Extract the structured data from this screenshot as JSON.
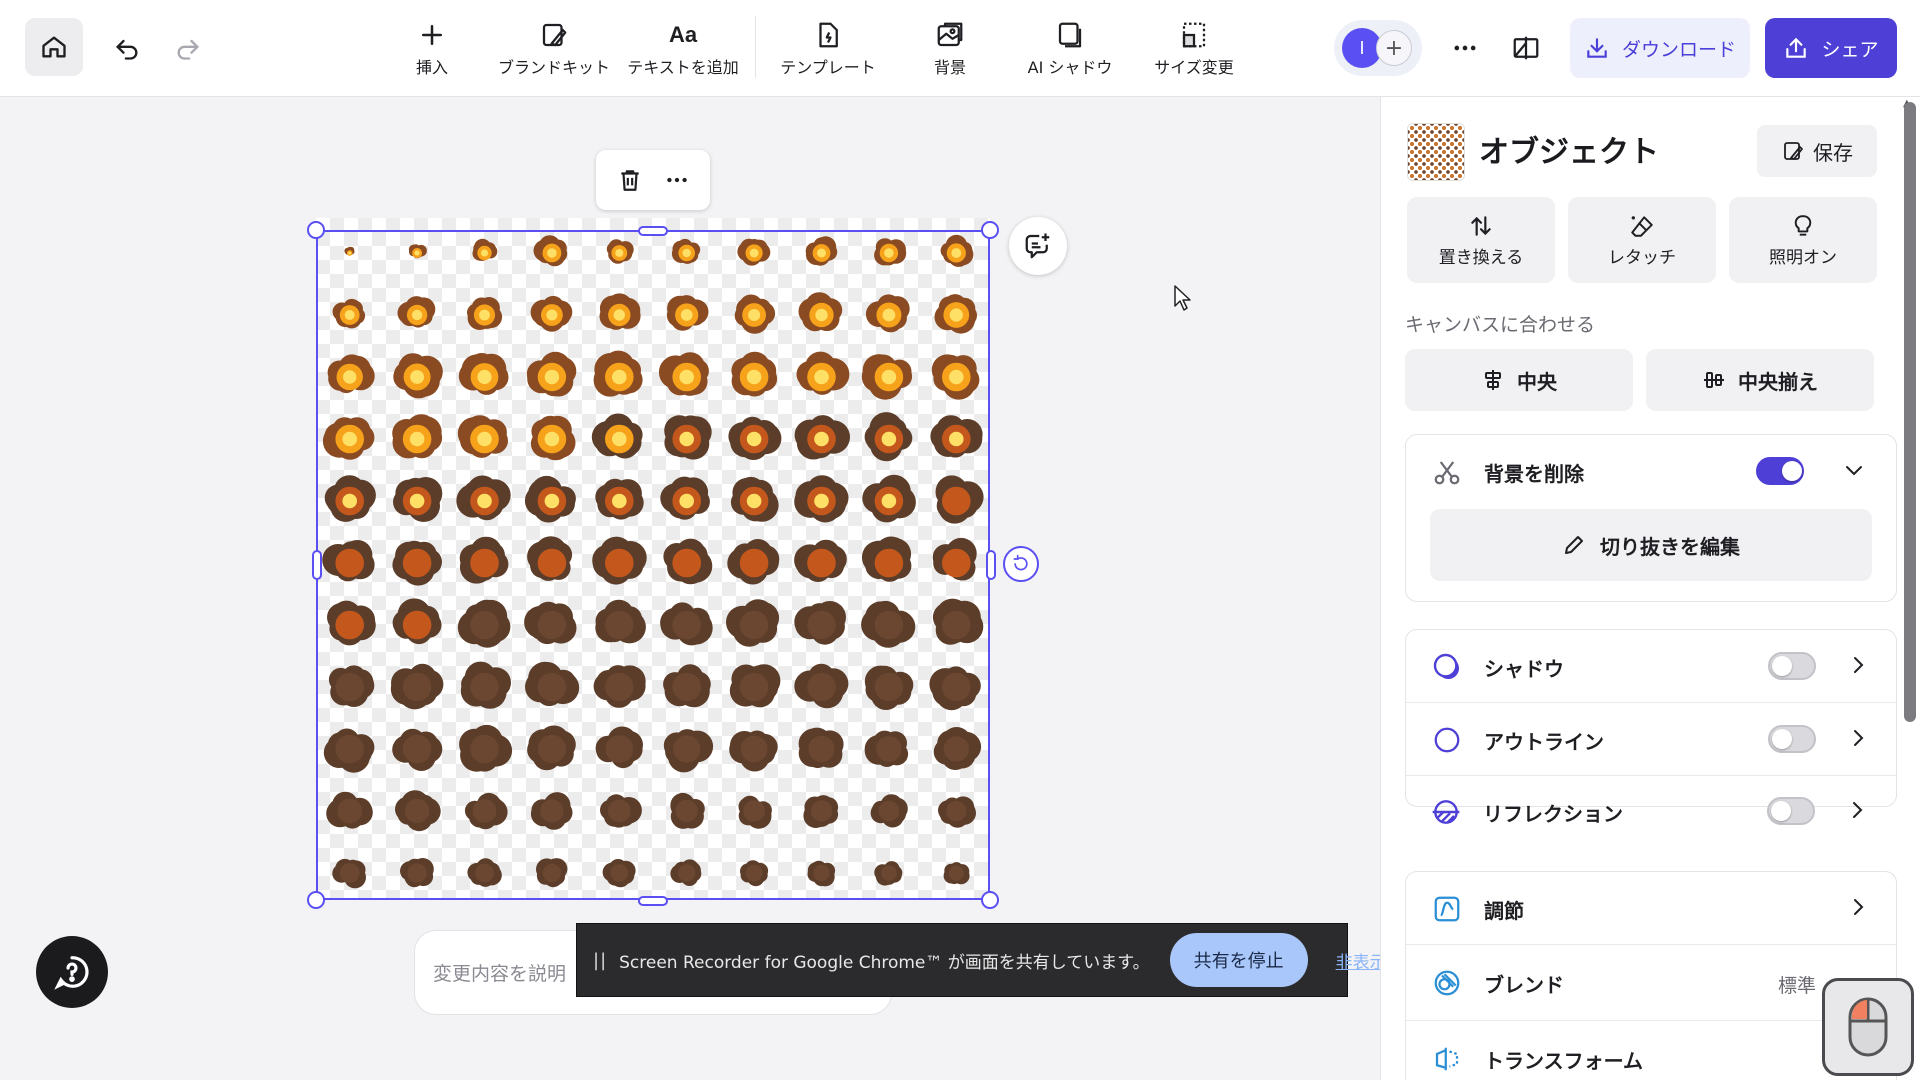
{
  "toolbar": {
    "insert": "挿入",
    "brand_kit": "ブランドキット",
    "add_text": "テキストを追加",
    "add_text_glyph": "Aa",
    "template": "テンプレート",
    "background": "背景",
    "ai_shadow": "AI シャドウ",
    "resize": "サイズ変更",
    "avatar_initial": "I",
    "download": "ダウンロード",
    "share": "シェア"
  },
  "canvas": {
    "prompt_placeholder": "変更内容を説明",
    "sprite_grid": {
      "rows": 11,
      "cols": 10
    }
  },
  "share_notice": {
    "text": "Screen Recorder for Google Chrome™ が画面を共有しています。",
    "stop": "共有を停止",
    "hide": "非表示"
  },
  "panel": {
    "title": "オブジェクト",
    "save": "保存",
    "quick_actions": [
      "置き換える",
      "レタッチ",
      "照明オン"
    ],
    "fit_label": "キャンバスに合わせる",
    "fit_buttons": [
      "中央",
      "中央揃え"
    ],
    "remove_bg": {
      "label": "背景を削除",
      "enabled": true,
      "edit_cutout": "切り抜きを編集"
    },
    "effects": [
      {
        "label": "シャドウ",
        "enabled": false
      },
      {
        "label": "アウトライン",
        "enabled": false
      },
      {
        "label": "リフレクション",
        "enabled": false
      }
    ],
    "adjust": "調節",
    "blend": {
      "label": "ブレンド",
      "value": "標準"
    },
    "transform": "トランスフォーム"
  },
  "colors": {
    "accent": "#4e3fd6",
    "selection": "#5a4ff2"
  }
}
